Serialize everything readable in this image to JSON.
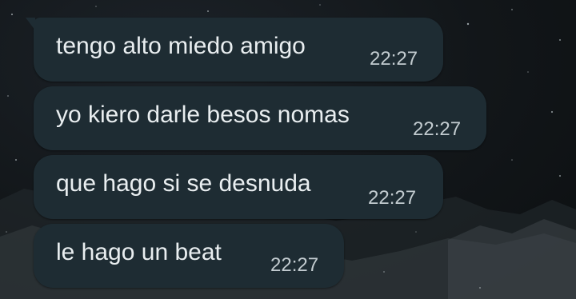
{
  "chat": {
    "messages": [
      {
        "text": "tengo alto miedo amigo",
        "time": "22:27"
      },
      {
        "text": "yo kiero darle besos nomas",
        "time": "22:27"
      },
      {
        "text": "que hago si se desnuda",
        "time": "22:27"
      },
      {
        "text": "le hago un beat",
        "time": "22:27"
      }
    ]
  },
  "colors": {
    "bubble": "#1e2c33",
    "text": "#e9eef0",
    "time": "#c3ccd0",
    "background": "#121619"
  }
}
